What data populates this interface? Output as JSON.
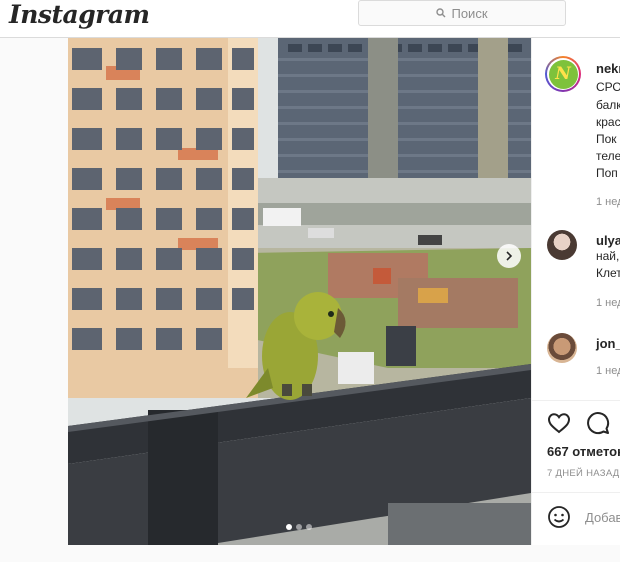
{
  "header": {
    "logo_text": "Instagram",
    "search_placeholder": "Поиск"
  },
  "post": {
    "author": {
      "username": "nekr",
      "avatar_letter": "N"
    },
    "caption_lines": [
      "СРО",
      "балк",
      "крас",
      "Пок",
      "теле",
      "Поп"
    ],
    "caption_time": "1 нед",
    "comments": [
      {
        "username": "ulya",
        "lines": [
          "най,",
          "Клет"
        ],
        "time": "1 нед"
      },
      {
        "username": "jon_",
        "lines": [],
        "time": "1 нед"
      }
    ],
    "likes_text": "667 отметок",
    "date_text": "7 ДНЕЙ НАЗАД",
    "add_comment_placeholder": "Добав",
    "carousel": {
      "slide_count": 3,
      "active_index": 0
    }
  },
  "colors": {
    "brand_text": "#262626",
    "muted": "#8e8e8e",
    "border": "#dbdbdb",
    "parrot_green": "#a9b33a"
  },
  "icons": {
    "search": "search-icon",
    "like": "heart-icon",
    "comment": "comment-icon",
    "emoji": "smiley-icon",
    "next": "chevron-right-icon"
  }
}
